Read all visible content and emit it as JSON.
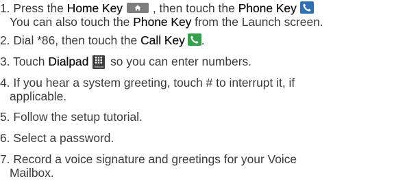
{
  "steps": [
    {
      "num": "1.",
      "a": "Press the ",
      "b": "Home Key",
      "c": ", then touch the ",
      "d": "Phone Key",
      "e": "",
      "line2a": "You can also touch the ",
      "line2b": "Phone Key",
      "line2c": " from the Launch screen."
    },
    {
      "num": "2.",
      "a": "Dial *86, then touch the ",
      "b": "Call Key",
      "c": "."
    },
    {
      "num": "3.",
      "a": "Touch ",
      "b": "Dialpad",
      "c": " so you can enter numbers.",
      "icon_caption": "Dialpad"
    },
    {
      "num": "4.",
      "a": "If you hear a system greeting, touch # to interrupt it, if",
      "line2": "applicable."
    },
    {
      "num": "5.",
      "a": "Follow the setup tutorial."
    },
    {
      "num": "6.",
      "a": "Select a password."
    },
    {
      "num": "7.",
      "a": "Record a voice signature and greetings for your Voice",
      "line2": "Mailbox."
    }
  ],
  "icons": {
    "home": "home-icon",
    "phone": "phone-icon",
    "call": "call-icon",
    "dialpad": "dialpad-icon"
  },
  "colors": {
    "text": "#3a3a3a",
    "home_key_bg": "#7d7d7d",
    "phone_key_bg": "#2f6fb5",
    "call_key_bg": "#33a04a",
    "dialpad_bg": "#3e3e3e"
  }
}
